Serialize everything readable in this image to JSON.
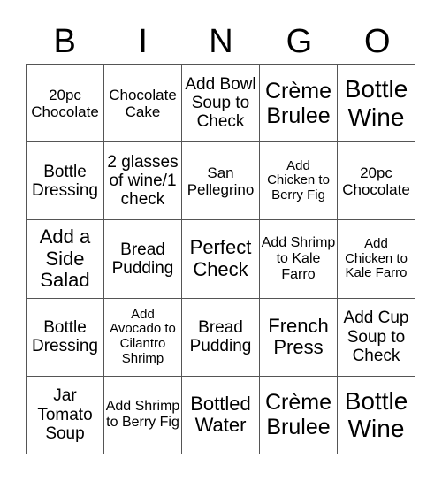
{
  "header": [
    "B",
    "I",
    "N",
    "G",
    "O"
  ],
  "cells": [
    [
      "20pc Chocolate",
      "Chocolate Cake",
      "Add Bowl Soup to Check",
      "Crème Brulee",
      "Bottle Wine"
    ],
    [
      "Bottle Dressing",
      "2 glasses of wine/1 check",
      "San Pellegrino",
      "Add Chicken to Berry Fig",
      "20pc Chocolate"
    ],
    [
      "Add a Side Salad",
      "Bread Pudding",
      "Perfect Check",
      "Add Shrimp to Kale Farro",
      "Add Chicken to Kale Farro"
    ],
    [
      "Bottle Dressing",
      "Add Avocado to Cilantro Shrimp",
      "Bread Pudding",
      "French Press",
      "Add Cup Soup to Check"
    ],
    [
      "Jar Tomato Soup",
      "Add Shrimp to Berry Fig",
      "Bottled Water",
      "Crème Brulee",
      "Bottle Wine"
    ]
  ]
}
